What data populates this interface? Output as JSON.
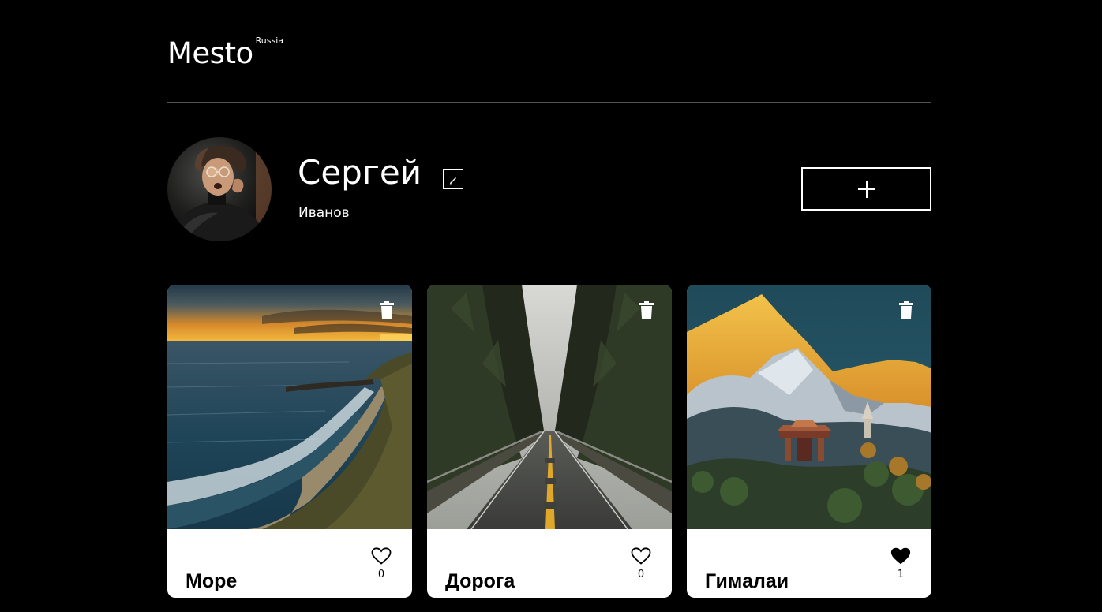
{
  "header": {
    "logo": "Mesto",
    "logo_sup": "Russia"
  },
  "profile": {
    "name": "Сергей",
    "about": "Иванов",
    "edit_icon": "pencil-icon",
    "add_icon": "plus-icon"
  },
  "cards": [
    {
      "title": "Море",
      "likes": "0",
      "liked": false,
      "image": "sea-coast-sunset"
    },
    {
      "title": "Дорога",
      "likes": "0",
      "liked": false,
      "image": "forest-road"
    },
    {
      "title": "Гималаи",
      "likes": "1",
      "liked": true,
      "image": "himalaya-mountains"
    }
  ],
  "colors": {
    "background": "#000000",
    "header_line": "#545454",
    "card_bg": "#ffffff",
    "text_dark": "#000000",
    "text_light": "#ffffff"
  }
}
